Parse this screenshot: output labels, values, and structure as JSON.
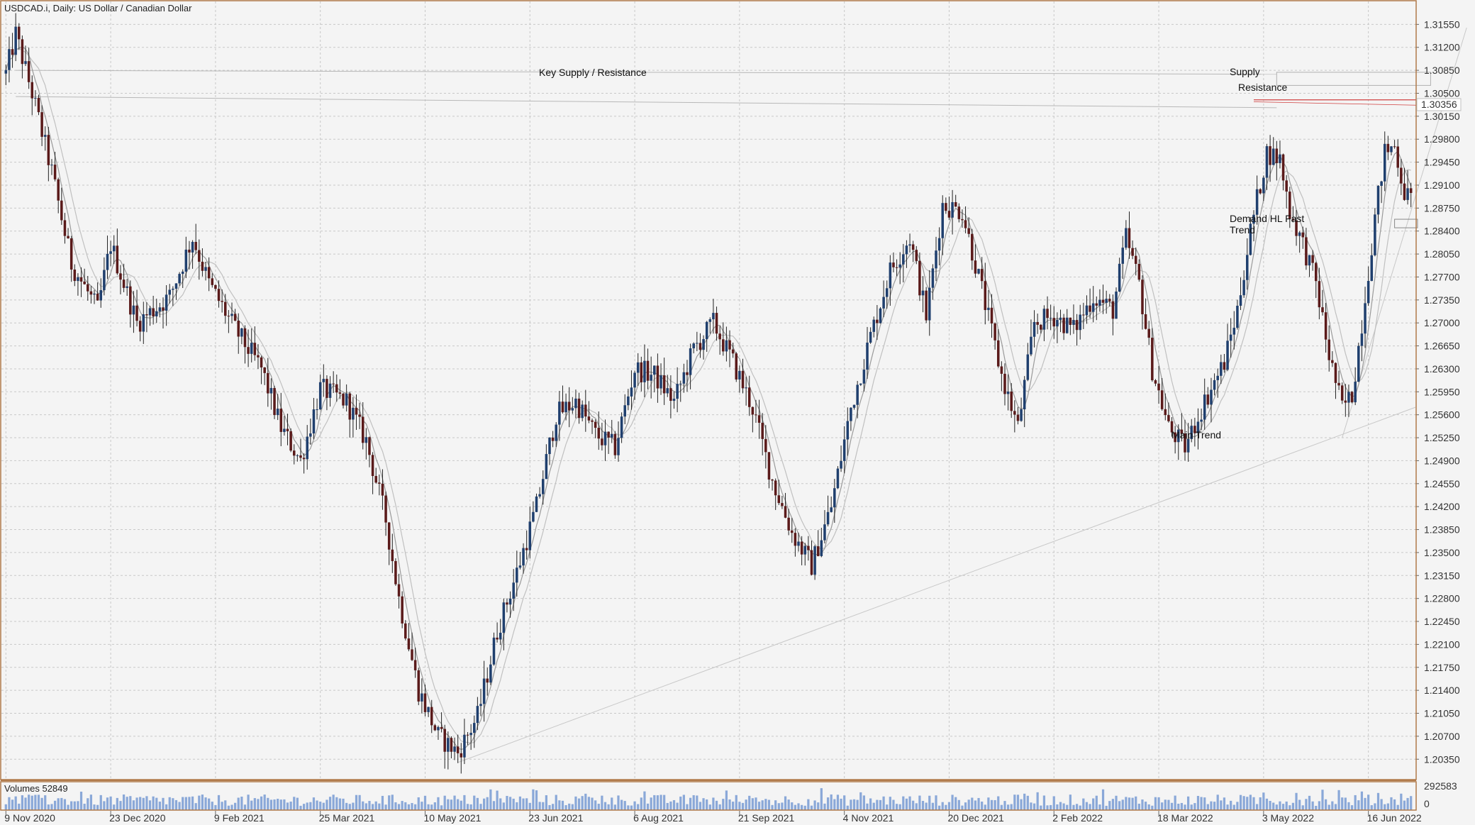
{
  "window": {
    "title": "USDCAD.i, Daily:  US Dollar / Canadian Dollar"
  },
  "volume_panel": {
    "label": "Volumes 52849",
    "scale_top": "292583",
    "scale_bottom": "0"
  },
  "current_price": "1.30356",
  "annotations": {
    "key_supply": "Key Supply / Resistance",
    "supply": "Supply",
    "resistance": "Resistance",
    "demand_line1": "Demand HL Fast",
    "demand_line2": "Trend",
    "main_trend": "Main Trend"
  },
  "colors": {
    "background": "#f4f4f4",
    "grid": "#c8c8c8",
    "frame": "#b07a4a",
    "bull": "#1f3f6e",
    "bear": "#5a1a1a",
    "wick": "#222222",
    "ma_fast": "#9a9a9a",
    "ma_slow": "#c0c0c0",
    "resistance_line": "#d04040",
    "trendline": "#c8c8c8",
    "volume": "#8aa8d8"
  },
  "chart_data": {
    "type": "candlestick",
    "symbol": "USDCAD.i",
    "timeframe": "Daily",
    "ylim": [
      1.2005,
      1.319
    ],
    "y_ticks": [
      "1.31550",
      "1.31200",
      "1.30850",
      "1.30500",
      "1.30150",
      "1.29800",
      "1.29450",
      "1.29100",
      "1.28750",
      "1.28400",
      "1.28050",
      "1.27700",
      "1.27350",
      "1.27000",
      "1.26650",
      "1.26300",
      "1.25950",
      "1.25600",
      "1.25250",
      "1.24900",
      "1.24550",
      "1.24200",
      "1.23850",
      "1.23500",
      "1.23150",
      "1.22800",
      "1.22450",
      "1.22100",
      "1.21750",
      "1.21400",
      "1.21050",
      "1.20700",
      "1.20350"
    ],
    "x_labels": [
      "9 Nov 2020",
      "23 Dec 2020",
      "9 Feb 2021",
      "25 Mar 2021",
      "10 May 2021",
      "23 Jun 2021",
      "6 Aug 2021",
      "21 Sep 2021",
      "4 Nov 2021",
      "20 Dec 2021",
      "2 Feb 2022",
      "18 Mar 2022",
      "3 May 2022",
      "16 Jun 2022"
    ],
    "x_label_bars": [
      0,
      32,
      64,
      96,
      128,
      160,
      192,
      224,
      256,
      288,
      320,
      352,
      384,
      416
    ],
    "bar_count": 430,
    "price_path": [
      [
        0,
        1.308
      ],
      [
        3,
        1.314
      ],
      [
        8,
        1.305
      ],
      [
        14,
        1.293
      ],
      [
        20,
        1.279
      ],
      [
        28,
        1.272
      ],
      [
        32,
        1.282
      ],
      [
        40,
        1.27
      ],
      [
        50,
        1.274
      ],
      [
        57,
        1.283
      ],
      [
        62,
        1.276
      ],
      [
        70,
        1.269
      ],
      [
        78,
        1.263
      ],
      [
        84,
        1.254
      ],
      [
        90,
        1.249
      ],
      [
        96,
        1.26
      ],
      [
        104,
        1.258
      ],
      [
        110,
        1.252
      ],
      [
        116,
        1.24
      ],
      [
        120,
        1.228
      ],
      [
        126,
        1.214
      ],
      [
        132,
        1.207
      ],
      [
        138,
        1.2045
      ],
      [
        144,
        1.21
      ],
      [
        150,
        1.223
      ],
      [
        156,
        1.232
      ],
      [
        162,
        1.242
      ],
      [
        168,
        1.256
      ],
      [
        174,
        1.258
      ],
      [
        180,
        1.253
      ],
      [
        186,
        1.251
      ],
      [
        192,
        1.263
      ],
      [
        198,
        1.262
      ],
      [
        204,
        1.258
      ],
      [
        210,
        1.266
      ],
      [
        216,
        1.27
      ],
      [
        222,
        1.264
      ],
      [
        228,
        1.257
      ],
      [
        234,
        1.246
      ],
      [
        240,
        1.238
      ],
      [
        246,
        1.233
      ],
      [
        252,
        1.242
      ],
      [
        258,
        1.257
      ],
      [
        264,
        1.268
      ],
      [
        270,
        1.278
      ],
      [
        276,
        1.283
      ],
      [
        281,
        1.271
      ],
      [
        286,
        1.288
      ],
      [
        292,
        1.287
      ],
      [
        298,
        1.275
      ],
      [
        304,
        1.262
      ],
      [
        309,
        1.254
      ],
      [
        314,
        1.27
      ],
      [
        320,
        1.271
      ],
      [
        326,
        1.269
      ],
      [
        332,
        1.274
      ],
      [
        338,
        1.272
      ],
      [
        342,
        1.283
      ],
      [
        346,
        1.276
      ],
      [
        350,
        1.263
      ],
      [
        355,
        1.254
      ],
      [
        360,
        1.251
      ],
      [
        366,
        1.258
      ],
      [
        372,
        1.264
      ],
      [
        376,
        1.272
      ],
      [
        380,
        1.284
      ],
      [
        385,
        1.296
      ],
      [
        389,
        1.295
      ],
      [
        392,
        1.287
      ],
      [
        396,
        1.282
      ],
      [
        400,
        1.276
      ],
      [
        404,
        1.265
      ],
      [
        408,
        1.257
      ],
      [
        411,
        1.259
      ],
      [
        414,
        1.27
      ],
      [
        418,
        1.286
      ],
      [
        421,
        1.296
      ],
      [
        424,
        1.297
      ],
      [
        427,
        1.29
      ],
      [
        430,
        1.288
      ],
      [
        433,
        1.303
      ]
    ],
    "annotations": [
      {
        "text": "Key Supply / Resistance",
        "price": 1.3074
      },
      {
        "text": "Supply",
        "price": 1.3072
      },
      {
        "text": "Resistance",
        "price": 1.304
      },
      {
        "text": "Demand HL Fast Trend",
        "price": 1.2845
      },
      {
        "text": "Main Trend",
        "price": 1.2525
      }
    ]
  }
}
